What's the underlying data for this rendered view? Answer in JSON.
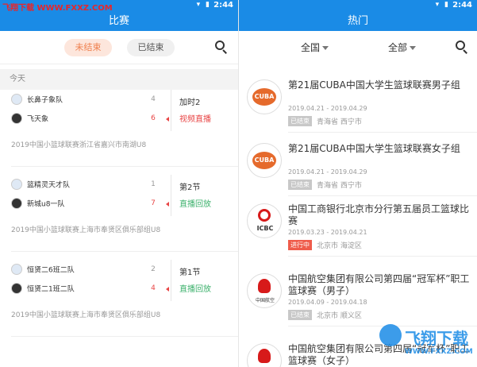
{
  "watermark": {
    "top": "飞翔下载 WWW.FXXZ.COM",
    "brand": "飞翔下载",
    "url": "WWW.FXXZ.COM"
  },
  "left": {
    "statusbar": {
      "time": "2:44"
    },
    "title": "比赛",
    "filters": {
      "active": "未结束",
      "inactive": "已结束"
    },
    "section": "今天",
    "matches": [
      {
        "home": "长鼻子象队",
        "away": "飞天象",
        "home_score": "4",
        "away_score": "6",
        "stage": "加时2",
        "status": "视频直播",
        "status_type": "red",
        "league": "2019中国小篮球联赛浙江省嘉兴市南湖U8"
      },
      {
        "home": "篮精灵天才队",
        "away": "新城u8一队",
        "home_score": "1",
        "away_score": "7",
        "stage": "第2节",
        "status": "直播回放",
        "status_type": "green",
        "league": "2019中国小篮球联赛上海市奉贤区俱乐部组U8"
      },
      {
        "home": "恒贤二6班二队",
        "away": "恒贤二1班二队",
        "home_score": "2",
        "away_score": "4",
        "stage": "第1节",
        "status": "直播回放",
        "status_type": "green",
        "league": "2019中国小篮球联赛上海市奉贤区俱乐部组U8"
      }
    ]
  },
  "right": {
    "statusbar": {
      "time": "2:44"
    },
    "title": "热门",
    "filters": {
      "region": "全国",
      "category": "全部"
    },
    "events": [
      {
        "logo": "CUBA",
        "title": "第21届CUBA中国大学生篮球联赛男子组",
        "dates": "2019.04.21 - 2019.04.29",
        "badge": "已结束",
        "badge_type": "over",
        "location": "青海省 西宁市"
      },
      {
        "logo": "CUBA",
        "title": "第21届CUBA中国大学生篮球联赛女子组",
        "dates": "2019.04.21 - 2019.04.29",
        "badge": "已结束",
        "badge_type": "over",
        "location": "青海省 西宁市"
      },
      {
        "logo": "ICBC",
        "title": "中国工商银行北京市分行第五届员工篮球比赛",
        "dates": "2019.03.23 - 2019.04.21",
        "badge": "进行中",
        "badge_type": "live",
        "location": "北京市 海淀区"
      },
      {
        "logo": "中国航空",
        "title": "中国航空集团有限公司第四届“冠军杯”职工篮球赛（男子）",
        "dates": "2019.04.09 - 2019.04.18",
        "badge": "已结束",
        "badge_type": "over",
        "location": "北京市 顺义区"
      },
      {
        "logo": "",
        "title": "中国航空集团有限公司第四届“冠军杯”职工篮球赛（女子）",
        "dates": "",
        "badge": "",
        "badge_type": "over",
        "location": ""
      }
    ]
  },
  "colors": {
    "primary": "#1a8be6",
    "accent": "#ef7f4d",
    "live_red": "#e84545",
    "replay_green": "#3bb06b"
  }
}
